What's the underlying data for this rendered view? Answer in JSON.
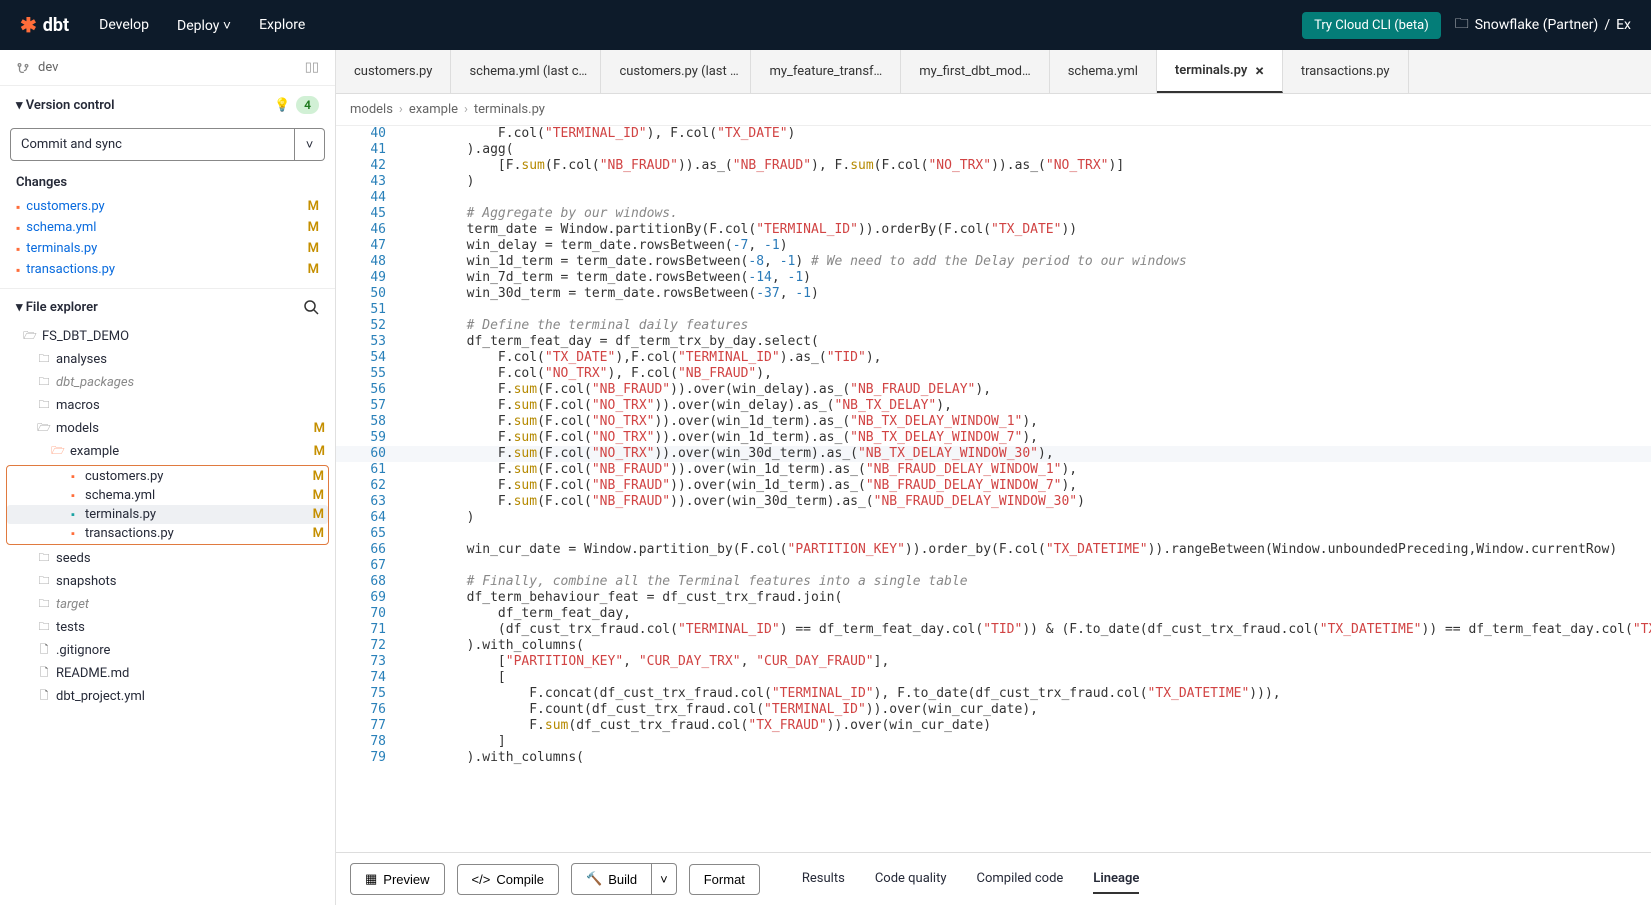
{
  "topbar": {
    "logo": "dbt",
    "nav": {
      "develop": "Develop",
      "deploy": "Deploy",
      "explore": "Explore"
    },
    "try_cli": "Try Cloud CLI (beta)",
    "partner": "Snowflake (Partner)",
    "sep": "/",
    "extra": "Ex"
  },
  "branch": {
    "name": "dev"
  },
  "vc": {
    "header": "Version control",
    "badge": "4",
    "commit_label": "Commit and sync",
    "changes_label": "Changes",
    "changes": [
      {
        "name": "customers.py",
        "status": "M"
      },
      {
        "name": "schema.yml",
        "status": "M"
      },
      {
        "name": "terminals.py",
        "status": "M"
      },
      {
        "name": "transactions.py",
        "status": "M"
      }
    ]
  },
  "fe": {
    "header": "File explorer"
  },
  "tree": {
    "root": "FS_DBT_DEMO",
    "analyses": "analyses",
    "dbt_packages": "dbt_packages",
    "macros": "macros",
    "models": "models",
    "models_status": "M",
    "example": "example",
    "example_status": "M",
    "customers": "customers.py",
    "schema": "schema.yml",
    "terminals": "terminals.py",
    "transactions": "transactions.py",
    "seeds": "seeds",
    "snapshots": "snapshots",
    "target": "target",
    "tests": "tests",
    "gitignore": ".gitignore",
    "readme": "README.md",
    "dbt_project": "dbt_project.yml"
  },
  "tabs": [
    "customers.py",
    "schema.yml (last c…",
    "customers.py (last …",
    "my_feature_transf…",
    "my_first_dbt_mod…",
    "schema.yml",
    "terminals.py",
    "transactions.py"
  ],
  "breadcrumbs": {
    "a": "models",
    "b": "example",
    "c": "terminals.py"
  },
  "bottom": {
    "preview": "Preview",
    "compile": "Compile",
    "build": "Build",
    "format": "Format",
    "results": "Results",
    "code_quality": "Code quality",
    "compiled": "Compiled code",
    "lineage": "Lineage"
  },
  "code": [
    {
      "n": 40,
      "tokens": [
        [
          "p",
          "            F.col("
        ],
        [
          "s",
          "\"TERMINAL_ID\""
        ],
        [
          "p",
          "), F.col("
        ],
        [
          "s",
          "\"TX_DATE\""
        ],
        [
          "p",
          ")"
        ]
      ]
    },
    {
      "n": 41,
      "tokens": [
        [
          "p",
          "        ).agg("
        ]
      ]
    },
    {
      "n": 42,
      "tokens": [
        [
          "p",
          "            [F."
        ],
        [
          "f",
          "sum"
        ],
        [
          "p",
          "(F.col("
        ],
        [
          "s",
          "\"NB_FRAUD\""
        ],
        [
          "p",
          ")).as_("
        ],
        [
          "s",
          "\"NB_FRAUD\""
        ],
        [
          "p",
          "), F."
        ],
        [
          "f",
          "sum"
        ],
        [
          "p",
          "(F.col("
        ],
        [
          "s",
          "\"NO_TRX\""
        ],
        [
          "p",
          ")).as_("
        ],
        [
          "s",
          "\"NO_TRX\""
        ],
        [
          "p",
          ")]"
        ]
      ]
    },
    {
      "n": 43,
      "tokens": [
        [
          "p",
          "        )"
        ]
      ]
    },
    {
      "n": 44,
      "tokens": [
        [
          "p",
          ""
        ]
      ]
    },
    {
      "n": 45,
      "tokens": [
        [
          "p",
          "        "
        ],
        [
          "c",
          "# Aggregate by our windows."
        ]
      ]
    },
    {
      "n": 46,
      "tokens": [
        [
          "p",
          "        term_date = Window.partitionBy(F.col("
        ],
        [
          "s",
          "\"TERMINAL_ID\""
        ],
        [
          "p",
          ")).orderBy(F.col("
        ],
        [
          "s",
          "\"TX_DATE\""
        ],
        [
          "p",
          "))"
        ]
      ]
    },
    {
      "n": 47,
      "tokens": [
        [
          "p",
          "        win_delay = term_date.rowsBetween("
        ],
        [
          "n",
          "-7"
        ],
        [
          "p",
          ", "
        ],
        [
          "n",
          "-1"
        ],
        [
          "p",
          ")"
        ]
      ]
    },
    {
      "n": 48,
      "tokens": [
        [
          "p",
          "        win_1d_term = term_date.rowsBetween("
        ],
        [
          "n",
          "-8"
        ],
        [
          "p",
          ", "
        ],
        [
          "n",
          "-1"
        ],
        [
          "p",
          ") "
        ],
        [
          "c",
          "# We need to add the Delay period to our windows"
        ]
      ]
    },
    {
      "n": 49,
      "tokens": [
        [
          "p",
          "        win_7d_term = term_date.rowsBetween("
        ],
        [
          "n",
          "-14"
        ],
        [
          "p",
          ", "
        ],
        [
          "n",
          "-1"
        ],
        [
          "p",
          ")"
        ]
      ]
    },
    {
      "n": 50,
      "tokens": [
        [
          "p",
          "        win_30d_term = term_date.rowsBetween("
        ],
        [
          "n",
          "-37"
        ],
        [
          "p",
          ", "
        ],
        [
          "n",
          "-1"
        ],
        [
          "p",
          ")"
        ]
      ]
    },
    {
      "n": 51,
      "tokens": [
        [
          "p",
          ""
        ]
      ]
    },
    {
      "n": 52,
      "tokens": [
        [
          "p",
          "        "
        ],
        [
          "c",
          "# Define the terminal daily features"
        ]
      ]
    },
    {
      "n": 53,
      "tokens": [
        [
          "p",
          "        df_term_feat_day = df_term_trx_by_day.select("
        ]
      ]
    },
    {
      "n": 54,
      "tokens": [
        [
          "p",
          "            F.col("
        ],
        [
          "s",
          "\"TX_DATE\""
        ],
        [
          "p",
          "),F.col("
        ],
        [
          "s",
          "\"TERMINAL_ID\""
        ],
        [
          "p",
          ").as_("
        ],
        [
          "s",
          "\"TID\""
        ],
        [
          "p",
          "),"
        ]
      ]
    },
    {
      "n": 55,
      "tokens": [
        [
          "p",
          "            F.col("
        ],
        [
          "s",
          "\"NO_TRX\""
        ],
        [
          "p",
          "), F.col("
        ],
        [
          "s",
          "\"NB_FRAUD\""
        ],
        [
          "p",
          "),"
        ]
      ]
    },
    {
      "n": 56,
      "tokens": [
        [
          "p",
          "            F."
        ],
        [
          "f",
          "sum"
        ],
        [
          "p",
          "(F.col("
        ],
        [
          "s",
          "\"NB_FRAUD\""
        ],
        [
          "p",
          ")).over(win_delay).as_("
        ],
        [
          "s",
          "\"NB_FRAUD_DELAY\""
        ],
        [
          "p",
          "),"
        ]
      ]
    },
    {
      "n": 57,
      "tokens": [
        [
          "p",
          "            F."
        ],
        [
          "f",
          "sum"
        ],
        [
          "p",
          "(F.col("
        ],
        [
          "s",
          "\"NO_TRX\""
        ],
        [
          "p",
          ")).over(win_delay).as_("
        ],
        [
          "s",
          "\"NB_TX_DELAY\""
        ],
        [
          "p",
          "),"
        ]
      ]
    },
    {
      "n": 58,
      "tokens": [
        [
          "p",
          "            F."
        ],
        [
          "f",
          "sum"
        ],
        [
          "p",
          "(F.col("
        ],
        [
          "s",
          "\"NO_TRX\""
        ],
        [
          "p",
          ")).over(win_1d_term).as_("
        ],
        [
          "s",
          "\"NB_TX_DELAY_WINDOW_1\""
        ],
        [
          "p",
          "),"
        ]
      ]
    },
    {
      "n": 59,
      "tokens": [
        [
          "p",
          "            F."
        ],
        [
          "f",
          "sum"
        ],
        [
          "p",
          "(F.col("
        ],
        [
          "s",
          "\"NO_TRX\""
        ],
        [
          "p",
          ")).over(win_1d_term).as_("
        ],
        [
          "s",
          "\"NB_TX_DELAY_WINDOW_7\""
        ],
        [
          "p",
          "),"
        ]
      ]
    },
    {
      "n": 60,
      "current": true,
      "tokens": [
        [
          "p",
          "            F."
        ],
        [
          "f",
          "sum"
        ],
        [
          "p",
          "(F.col("
        ],
        [
          "s",
          "\"NO_TRX\""
        ],
        [
          "p",
          ")).over(win_30d_term).as_("
        ],
        [
          "s",
          "\"NB_TX_DELAY_WINDOW_30\""
        ],
        [
          "p",
          "),"
        ]
      ]
    },
    {
      "n": 61,
      "tokens": [
        [
          "p",
          "            F."
        ],
        [
          "f",
          "sum"
        ],
        [
          "p",
          "(F.col("
        ],
        [
          "s",
          "\"NB_FRAUD\""
        ],
        [
          "p",
          ")).over(win_1d_term).as_("
        ],
        [
          "s",
          "\"NB_FRAUD_DELAY_WINDOW_1\""
        ],
        [
          "p",
          "),"
        ]
      ]
    },
    {
      "n": 62,
      "tokens": [
        [
          "p",
          "            F."
        ],
        [
          "f",
          "sum"
        ],
        [
          "p",
          "(F.col("
        ],
        [
          "s",
          "\"NB_FRAUD\""
        ],
        [
          "p",
          ")).over(win_1d_term).as_("
        ],
        [
          "s",
          "\"NB_FRAUD_DELAY_WINDOW_7\""
        ],
        [
          "p",
          "),"
        ]
      ]
    },
    {
      "n": 63,
      "tokens": [
        [
          "p",
          "            F."
        ],
        [
          "f",
          "sum"
        ],
        [
          "p",
          "(F.col("
        ],
        [
          "s",
          "\"NB_FRAUD\""
        ],
        [
          "p",
          ")).over(win_30d_term).as_("
        ],
        [
          "s",
          "\"NB_FRAUD_DELAY_WINDOW_30\""
        ],
        [
          "p",
          ")"
        ]
      ]
    },
    {
      "n": 64,
      "tokens": [
        [
          "p",
          "        )"
        ]
      ]
    },
    {
      "n": 65,
      "tokens": [
        [
          "p",
          ""
        ]
      ]
    },
    {
      "n": 66,
      "tokens": [
        [
          "p",
          "        win_cur_date = Window.partition_by(F.col("
        ],
        [
          "s",
          "\"PARTITION_KEY\""
        ],
        [
          "p",
          ")).order_by(F.col("
        ],
        [
          "s",
          "\"TX_DATETIME\""
        ],
        [
          "p",
          ")).rangeBetween(Window.unboundedPreceding,Window.currentRow)"
        ]
      ]
    },
    {
      "n": 67,
      "tokens": [
        [
          "p",
          ""
        ]
      ]
    },
    {
      "n": 68,
      "tokens": [
        [
          "p",
          "        "
        ],
        [
          "c",
          "# Finally, combine all the Terminal features into a single table"
        ]
      ]
    },
    {
      "n": 69,
      "tokens": [
        [
          "p",
          "        df_term_behaviour_feat = df_cust_trx_fraud.join("
        ]
      ]
    },
    {
      "n": 70,
      "tokens": [
        [
          "p",
          "            df_term_feat_day,"
        ]
      ]
    },
    {
      "n": 71,
      "tokens": [
        [
          "p",
          "            (df_cust_trx_fraud.col("
        ],
        [
          "s",
          "\"TERMINAL_ID\""
        ],
        [
          "p",
          ") == df_term_feat_day.col("
        ],
        [
          "s",
          "\"TID\""
        ],
        [
          "p",
          ")) & (F.to_date(df_cust_trx_fraud.col("
        ],
        [
          "s",
          "\"TX_DATETIME\""
        ],
        [
          "p",
          ")) == df_term_feat_day.col("
        ],
        [
          "s",
          "\"TX_DATE\""
        ],
        [
          "p",
          "))"
        ]
      ]
    },
    {
      "n": 72,
      "tokens": [
        [
          "p",
          "        ).with_columns("
        ]
      ]
    },
    {
      "n": 73,
      "tokens": [
        [
          "p",
          "            ["
        ],
        [
          "s",
          "\"PARTITION_KEY\""
        ],
        [
          "p",
          ", "
        ],
        [
          "s",
          "\"CUR_DAY_TRX\""
        ],
        [
          "p",
          ", "
        ],
        [
          "s",
          "\"CUR_DAY_FRAUD\""
        ],
        [
          "p",
          "],"
        ]
      ]
    },
    {
      "n": 74,
      "tokens": [
        [
          "p",
          "            ["
        ]
      ]
    },
    {
      "n": 75,
      "tokens": [
        [
          "p",
          "                F.concat(df_cust_trx_fraud.col("
        ],
        [
          "s",
          "\"TERMINAL_ID\""
        ],
        [
          "p",
          "), F.to_date(df_cust_trx_fraud.col("
        ],
        [
          "s",
          "\"TX_DATETIME\""
        ],
        [
          "p",
          "))),"
        ]
      ]
    },
    {
      "n": 76,
      "tokens": [
        [
          "p",
          "                F.count(df_cust_trx_fraud.col("
        ],
        [
          "s",
          "\"TERMINAL_ID\""
        ],
        [
          "p",
          ")).over(win_cur_date),"
        ]
      ]
    },
    {
      "n": 77,
      "tokens": [
        [
          "p",
          "                F."
        ],
        [
          "f",
          "sum"
        ],
        [
          "p",
          "(df_cust_trx_fraud.col("
        ],
        [
          "s",
          "\"TX_FRAUD\""
        ],
        [
          "p",
          ")).over(win_cur_date)"
        ]
      ]
    },
    {
      "n": 78,
      "tokens": [
        [
          "p",
          "            ]"
        ]
      ]
    },
    {
      "n": 79,
      "tokens": [
        [
          "p",
          "        ).with_columns("
        ]
      ]
    }
  ]
}
